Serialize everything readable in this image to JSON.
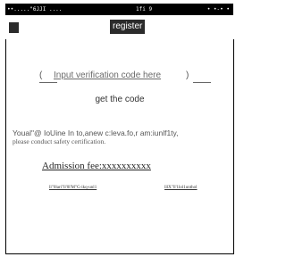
{
  "status_bar": {
    "left_text": "••.....\"6JJI ....",
    "center_text": "1fi 9",
    "right_text": "• •-• •"
  },
  "header": {
    "title": "register"
  },
  "verify": {
    "left_bracket": "(",
    "input_label": "Input verification code here",
    "right_bracket": ")"
  },
  "get_code_label": "get the code",
  "notice": {
    "line1": "Youal\"@ IoUine In to,anew c:leva.fo,r am:iunlf1ty,",
    "line2": "please conduct safety certification."
  },
  "fee_text": "Admission  fee:xxxxxxxxxx",
  "links": {
    "left": "ll\"0lari\"ll'0l'M\"G-ikq-unl1",
    "right": "lllX\"ll'1lol1unthol"
  },
  "colors": {
    "header_bg": "#2b2b2b",
    "status_bar_bg": "#000000",
    "text_gray": "#555555"
  },
  "icons": {
    "back": "back-icon"
  }
}
